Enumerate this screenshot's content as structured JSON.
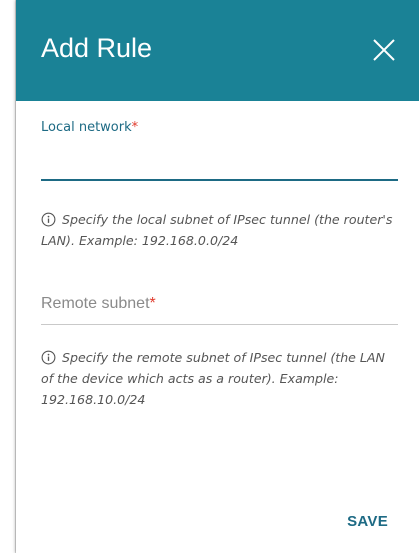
{
  "dialog": {
    "title": "Add Rule",
    "close_icon": "close-icon",
    "header_color": "#1a8296"
  },
  "local_network": {
    "label": "Local network",
    "required_mark": "*",
    "value": "",
    "hint_icon": "info-icon",
    "hint": "Specify the local subnet of IPsec tunnel (the router's LAN). Example: 192.168.0.0/24"
  },
  "remote_subnet": {
    "placeholder": "Remote subnet",
    "required_mark": "*",
    "value": "",
    "hint_icon": "info-icon",
    "hint": "Specify the remote subnet of IPsec tunnel (the LAN of the device which acts as a router). Example: 192.168.10.0/24"
  },
  "actions": {
    "save_label": "SAVE"
  },
  "colors": {
    "accent": "#1d6a84",
    "required": "#e0392b"
  }
}
